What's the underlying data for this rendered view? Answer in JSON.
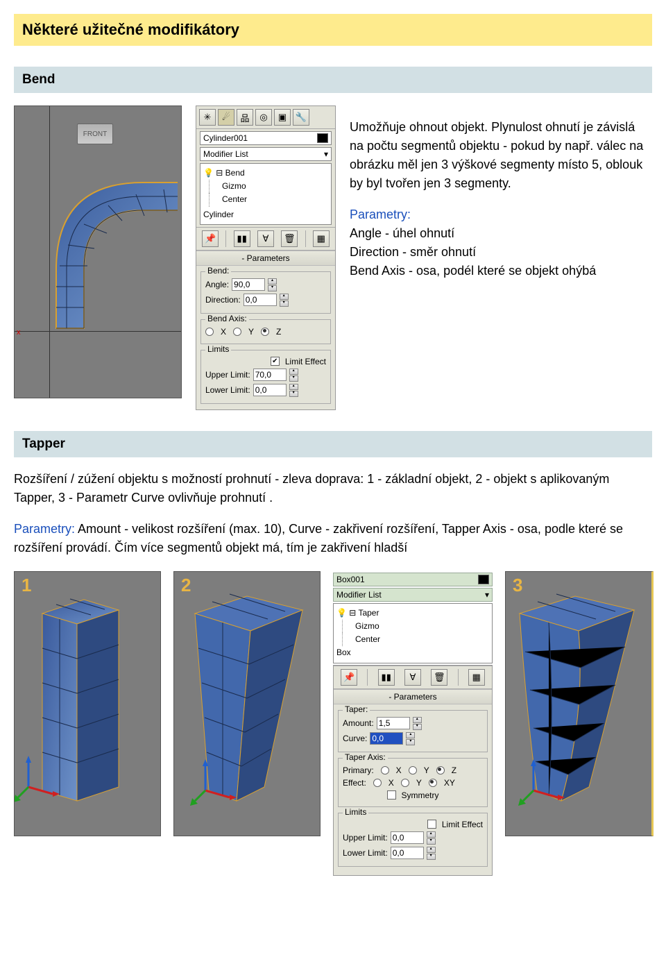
{
  "titles": {
    "main": "Některé užitečné modifikátory",
    "bend": "Bend",
    "tapper": "Tapper"
  },
  "bend": {
    "intro": "Umožňuje ohnout objekt. Plynulost ohnutí je závislá na počtu segmentů objektu - pokud by např. válec na obrázku měl jen 3 výškové segmenty místo 5, oblouk by byl tvořen jen 3 segmenty.",
    "params_label": "Parametry:",
    "p_angle": "Angle - úhel ohnutí",
    "p_direction": "Direction - směr ohnutí",
    "p_axis": "Bend Axis - osa, podél které se objekt ohýbá"
  },
  "panel": {
    "object_name": "Cylinder001",
    "modifier_list": "Modifier List",
    "tree_root": "Bend",
    "tree_gizmo": "Gizmo",
    "tree_center": "Center",
    "tree_base": "Cylinder",
    "section_params": "Parameters",
    "grp_bend": "Bend:",
    "lbl_angle": "Angle:",
    "val_angle": "90,0",
    "lbl_direction": "Direction:",
    "val_direction": "0,0",
    "grp_bendaxis": "Bend Axis:",
    "ax_x": "X",
    "ax_y": "Y",
    "ax_z": "Z",
    "grp_limits": "Limits",
    "chk_limit": "Limit Effect",
    "lbl_upper": "Upper Limit:",
    "val_upper": "70,0",
    "lbl_lower": "Lower Limit:",
    "val_lower": "0,0"
  },
  "viewport": {
    "front": "FRONT",
    "x": "x"
  },
  "tapper": {
    "body1": "Rozšíření / zúžení objektu s možností prohnutí - zleva doprava: 1 - základní objekt, 2 - objekt s aplikovaným Tapper, 3 - Parametr Curve ovlivňuje prohnutí .",
    "params_label": "Parametry:",
    "body2": " Amount - velikost rozšíření (max. 10), Curve - zakřivení rozšíření, Tapper Axis - osa, podle které se rozšíření provádí. Čím více segmentů objekt má, tím je zakřivení hladší"
  },
  "panel2": {
    "object_name": "Box001",
    "modifier_list": "Modifier List",
    "tree_root": "Taper",
    "tree_gizmo": "Gizmo",
    "tree_center": "Center",
    "tree_base": "Box",
    "section_params": "Parameters",
    "grp_taper": "Taper:",
    "lbl_amount": "Amount:",
    "val_amount": "1,5",
    "lbl_curve": "Curve:",
    "val_curve": "0,0",
    "grp_taperaxis": "Taper Axis:",
    "lbl_primary": "Primary:",
    "lbl_effect": "Effect:",
    "opt_xy": "XY",
    "chk_sym": "Symmetry",
    "grp_limits": "Limits",
    "chk_limit": "Limit Effect",
    "lbl_upper": "Upper Limit:",
    "val_upper": "0,0",
    "lbl_lower": "Lower Limit:",
    "val_lower": "0,0"
  },
  "numbers": {
    "n1": "1",
    "n2": "2",
    "n3": "3"
  }
}
